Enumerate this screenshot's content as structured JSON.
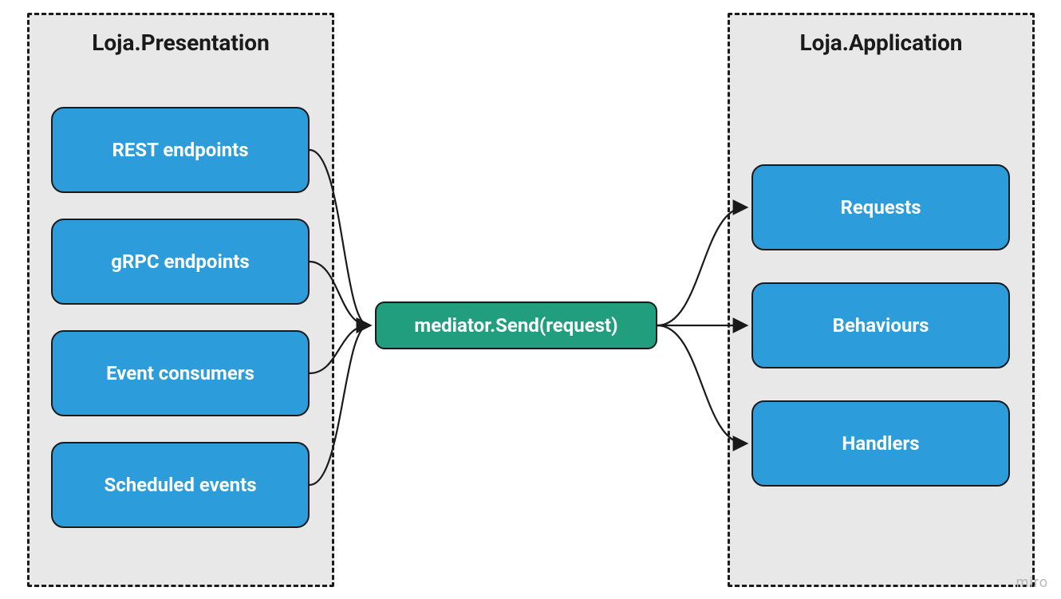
{
  "left_container": {
    "title": "Loja.Presentation",
    "boxes": [
      {
        "label": "REST endpoints"
      },
      {
        "label": "gRPC endpoints"
      },
      {
        "label": "Event consumers"
      },
      {
        "label": "Scheduled events"
      }
    ]
  },
  "center": {
    "label": "mediator.Send(request)"
  },
  "right_container": {
    "title": "Loja.Application",
    "boxes": [
      {
        "label": "Requests"
      },
      {
        "label": "Behaviours"
      },
      {
        "label": "Handlers"
      }
    ]
  },
  "watermark": "miro"
}
